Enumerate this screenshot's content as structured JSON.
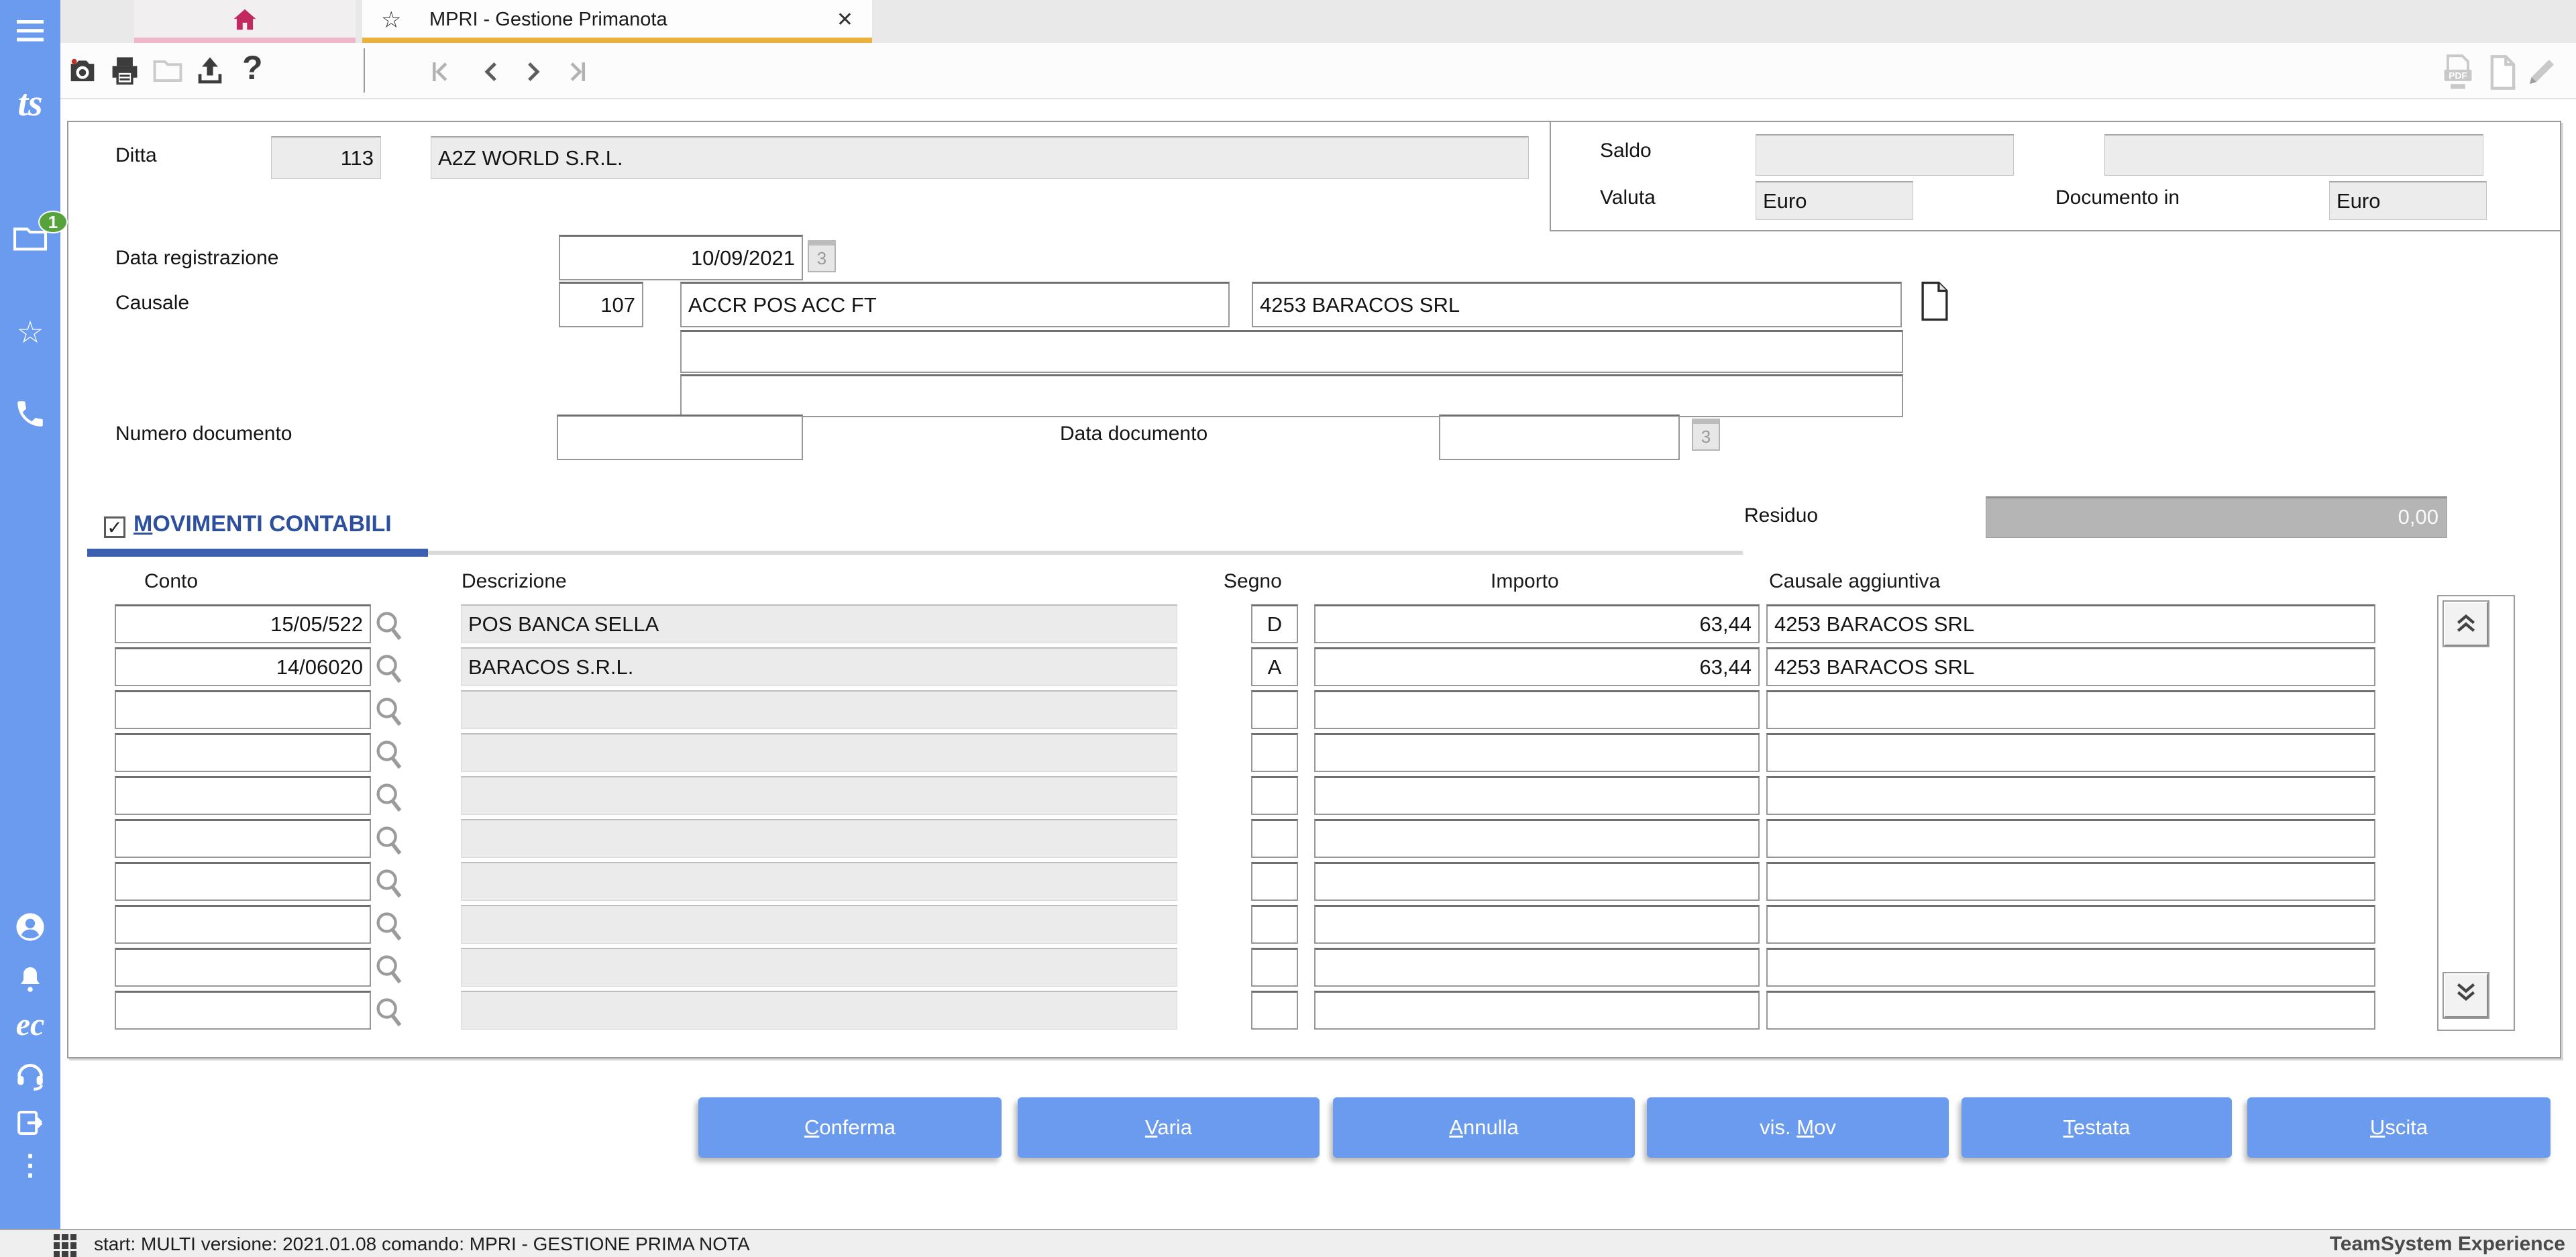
{
  "tabs": {
    "active_title": "MPRI - Gestione Primanota",
    "star_glyph": "☆",
    "close_glyph": "✕"
  },
  "toolbar": {
    "help_glyph": "?"
  },
  "sidebar": {
    "notification_count": "1",
    "ts_logo_text": "ts",
    "ec_logo_text": "ec",
    "more_glyph": "⋮"
  },
  "form": {
    "ditta_label": "Ditta",
    "ditta_code": "113",
    "ditta_name": "A2Z WORLD S.R.L.",
    "saldo_label": "Saldo",
    "saldo_value1": "",
    "saldo_value2": "",
    "valuta_label": "Valuta",
    "valuta_value": "Euro",
    "documento_in_label": "Documento in",
    "documento_in_value": "Euro",
    "data_registrazione_label": "Data registrazione",
    "data_registrazione_value": "10/09/2021",
    "causale_label": "Causale",
    "causale_code": "107",
    "causale_descrizione": "ACCR POS ACC FT",
    "causale_aggiuntiva": "4253 BARACOS SRL",
    "causale_extra1": "",
    "causale_extra2": "",
    "numero_documento_label": "Numero documento",
    "numero_documento_value": "",
    "data_documento_label": "Data documento",
    "data_documento_value": "",
    "calendar_glyph": "3"
  },
  "movimenti": {
    "section": {
      "label": "MOVIMENTI CONTABILI",
      "mnemonic": "M"
    },
    "checkbox_checked": "✓",
    "residuo_label": "Residuo",
    "residuo_value": "0,00",
    "columns": [
      "Conto",
      "Descrizione",
      "Segno",
      "Importo",
      "Causale aggiuntiva"
    ],
    "rows": [
      {
        "conto": "15/05/522",
        "descrizione": "POS BANCA SELLA",
        "segno": "D",
        "importo": "63,44",
        "causale": "4253 BARACOS SRL"
      },
      {
        "conto": "14/06020",
        "descrizione": "BARACOS S.R.L.",
        "segno": "A",
        "importo": "63,44",
        "causale": "4253 BARACOS SRL"
      },
      {
        "conto": "",
        "descrizione": "",
        "segno": "",
        "importo": "",
        "causale": ""
      },
      {
        "conto": "",
        "descrizione": "",
        "segno": "",
        "importo": "",
        "causale": ""
      },
      {
        "conto": "",
        "descrizione": "",
        "segno": "",
        "importo": "",
        "causale": ""
      },
      {
        "conto": "",
        "descrizione": "",
        "segno": "",
        "importo": "",
        "causale": ""
      },
      {
        "conto": "",
        "descrizione": "",
        "segno": "",
        "importo": "",
        "causale": ""
      },
      {
        "conto": "",
        "descrizione": "",
        "segno": "",
        "importo": "",
        "causale": ""
      },
      {
        "conto": "",
        "descrizione": "",
        "segno": "",
        "importo": "",
        "causale": ""
      },
      {
        "conto": "",
        "descrizione": "",
        "segno": "",
        "importo": "",
        "causale": ""
      }
    ]
  },
  "buttons": [
    {
      "label": "Conferma",
      "mnemonic": "C"
    },
    {
      "label": "Varia",
      "mnemonic": "V"
    },
    {
      "label": "Annulla",
      "mnemonic": "A"
    },
    {
      "label": "vis. Mov",
      "mnemonic": "M"
    },
    {
      "label": "Testata",
      "mnemonic": "T"
    },
    {
      "label": "Uscita",
      "mnemonic": "U"
    }
  ],
  "statusbar": {
    "text": "start: MULTI versione: 2021.01.08 comando: MPRI - GESTIONE PRIMA NOTA",
    "brand": "TeamSystem Experience"
  },
  "colors": {
    "accent_blue": "#6b9bee",
    "section_blue": "#2d4f9c",
    "active_tab_underline": "#e9b240",
    "home_tab_underline": "#f0b7ca",
    "home_icon": "#c2295e",
    "badge_green": "#57a33b"
  }
}
